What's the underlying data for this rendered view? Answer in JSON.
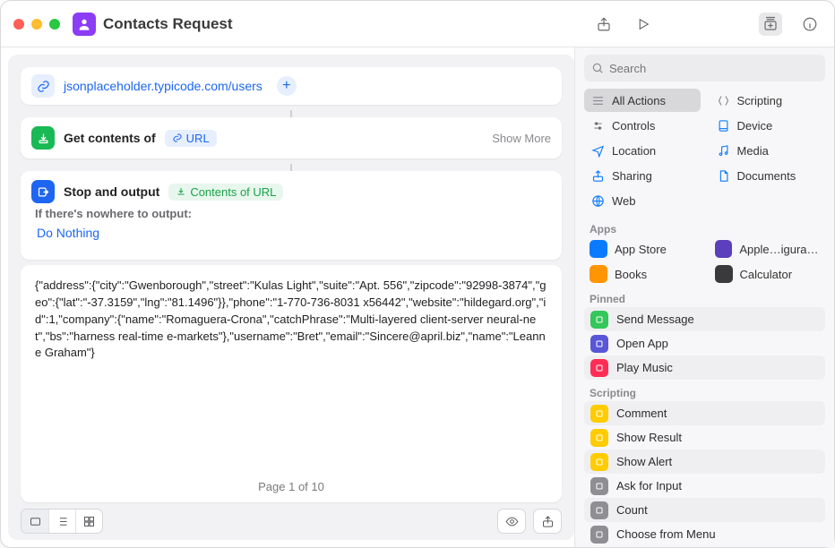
{
  "window": {
    "title": "Contacts Request"
  },
  "url_action": {
    "url": "jsonplaceholder.typicode.com/users"
  },
  "get_contents": {
    "title": "Get contents of",
    "param_label": "URL",
    "show_more": "Show More"
  },
  "stop_output": {
    "title": "Stop and output",
    "param_label": "Contents of URL",
    "nowhere_label": "If there's nowhere to output:",
    "do_nothing": "Do Nothing"
  },
  "output": {
    "json": "{\"address\":{\"city\":\"Gwenborough\",\"street\":\"Kulas Light\",\"suite\":\"Apt. 556\",\"zipcode\":\"92998-3874\",\"geo\":{\"lat\":\"-37.3159\",\"lng\":\"81.1496\"}},\"phone\":\"1-770-736-8031 x56442\",\"website\":\"hildegard.org\",\"id\":1,\"company\":{\"name\":\"Romaguera-Crona\",\"catchPhrase\":\"Multi-layered client-server neural-net\",\"bs\":\"harness real-time e-markets\"},\"username\":\"Bret\",\"email\":\"Sincere@april.biz\",\"name\":\"Leanne Graham\"}",
    "pager": "Page 1 of 10"
  },
  "search": {
    "placeholder": "Search"
  },
  "categories": [
    {
      "label": "All Actions",
      "color": "#8a8a8e",
      "selected": true
    },
    {
      "label": "Scripting",
      "color": "#8a8a8e"
    },
    {
      "label": "Controls",
      "color": "#8a8a8e"
    },
    {
      "label": "Device",
      "color": "#0a7aff"
    },
    {
      "label": "Location",
      "color": "#0a7aff"
    },
    {
      "label": "Media",
      "color": "#0a7aff"
    },
    {
      "label": "Sharing",
      "color": "#0a7aff"
    },
    {
      "label": "Documents",
      "color": "#0a7aff"
    },
    {
      "label": "Web",
      "color": "#0a7aff"
    }
  ],
  "sections": {
    "apps_label": "Apps",
    "apps": [
      {
        "label": "App Store",
        "color": "#0a7aff"
      },
      {
        "label": "Apple…igurator",
        "color": "#5b3fbc"
      },
      {
        "label": "Books",
        "color": "#ff9500"
      },
      {
        "label": "Calculator",
        "color": "#3a3a3c"
      }
    ],
    "pinned_label": "Pinned",
    "pinned": [
      {
        "label": "Send Message",
        "color": "#34c759"
      },
      {
        "label": "Open App",
        "color": "#5856d6"
      },
      {
        "label": "Play Music",
        "color": "#ff2d55"
      }
    ],
    "scripting_label": "Scripting",
    "scripting": [
      {
        "label": "Comment",
        "color": "#ffcc00"
      },
      {
        "label": "Show Result",
        "color": "#ffcc00"
      },
      {
        "label": "Show Alert",
        "color": "#ffcc00"
      },
      {
        "label": "Ask for Input",
        "color": "#8e8e93"
      },
      {
        "label": "Count",
        "color": "#8e8e93"
      },
      {
        "label": "Choose from Menu",
        "color": "#8e8e93"
      }
    ]
  }
}
